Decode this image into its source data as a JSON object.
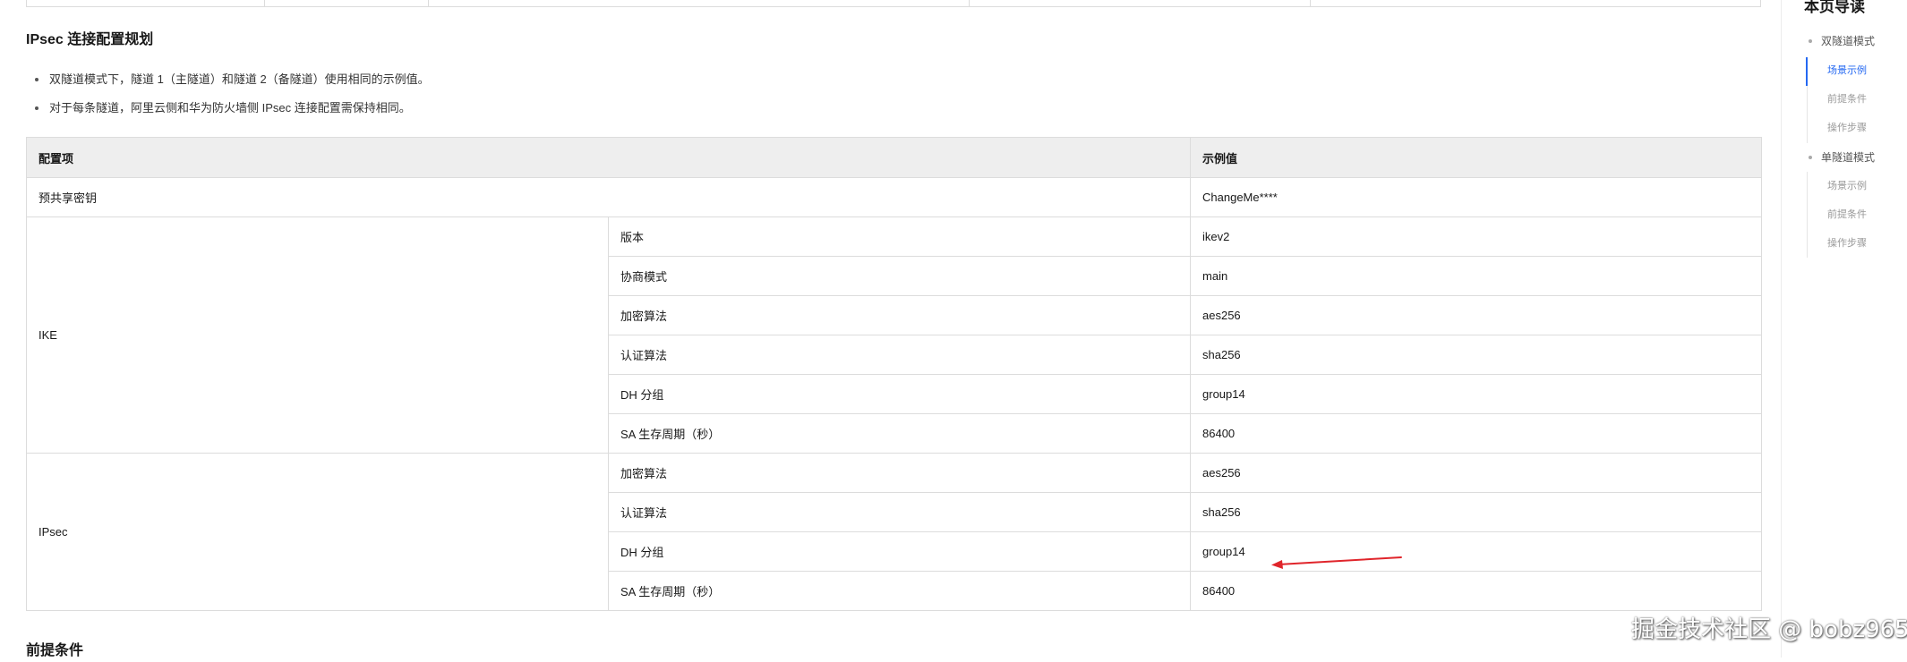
{
  "section": {
    "title": "IPsec 连接配置规划",
    "notes": [
      "双隧道模式下，隧道 1（主隧道）和隧道 2（备隧道）使用相同的示例值。",
      "对于每条隧道，阿里云侧和华为防火墙侧 IPsec 连接配置需保持相同。"
    ]
  },
  "table": {
    "headers": {
      "item": "配置项",
      "value": "示例值"
    },
    "psk": {
      "label": "预共享密钥",
      "value": "ChangeMe****"
    },
    "ike": {
      "label": "IKE",
      "rows": [
        {
          "param": "版本",
          "value": "ikev2"
        },
        {
          "param": "协商模式",
          "value": "main"
        },
        {
          "param": "加密算法",
          "value": "aes256"
        },
        {
          "param": "认证算法",
          "value": "sha256"
        },
        {
          "param": "DH 分组",
          "value": "group14"
        },
        {
          "param": "SA 生存周期（秒）",
          "value": "86400"
        }
      ]
    },
    "ipsec": {
      "label": "IPsec",
      "rows": [
        {
          "param": "加密算法",
          "value": "aes256"
        },
        {
          "param": "认证算法",
          "value": "sha256"
        },
        {
          "param": "DH 分组",
          "value": "group14"
        },
        {
          "param": "SA 生存周期（秒）",
          "value": "86400"
        }
      ]
    }
  },
  "next_section_title": "前提条件",
  "toc": {
    "title": "本页导读",
    "items": [
      {
        "label": "双隧道模式",
        "level": 1
      },
      {
        "label": "场景示例",
        "level": 2,
        "active": true
      },
      {
        "label": "前提条件",
        "level": 2
      },
      {
        "label": "操作步骤",
        "level": 2
      },
      {
        "label": "单隧道模式",
        "level": 1
      },
      {
        "label": "场景示例",
        "level": 2
      },
      {
        "label": "前提条件",
        "level": 2
      },
      {
        "label": "操作步骤",
        "level": 2
      }
    ]
  },
  "watermark": "掘金技术社区 @ bobz965",
  "colors": {
    "accent": "#2468f2",
    "annotation_arrow": "#e0252b",
    "header_bg": "#eeeeee"
  }
}
